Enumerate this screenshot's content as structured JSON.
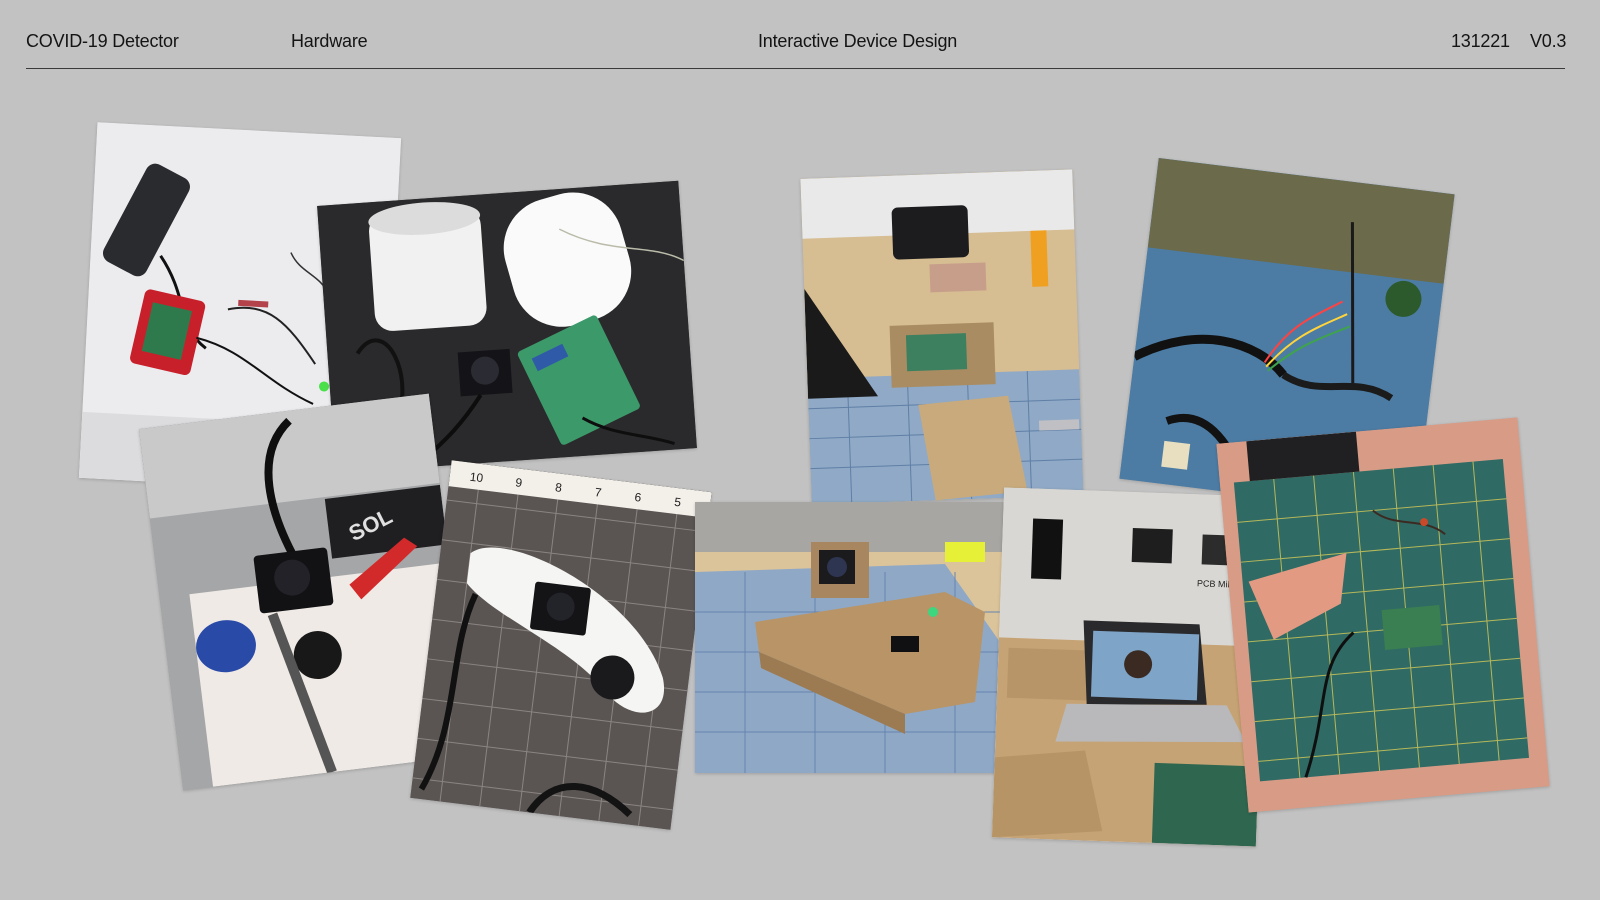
{
  "header": {
    "project": "COVID-19 Detector",
    "section": "Hardware",
    "course": "Interactive Device Design",
    "date": "131221",
    "version": "V0.3"
  },
  "gallery": {
    "photos": [
      {
        "id": "photo-pi-setup",
        "printed_text": []
      },
      {
        "id": "photo-pvc-enclosure",
        "printed_text": []
      },
      {
        "id": "photo-camera-helping-hand",
        "printed_text": [
          "SOL"
        ]
      },
      {
        "id": "photo-board-on-mat",
        "printed_text": [
          "10",
          "9",
          "8",
          "7",
          "6",
          "5"
        ]
      },
      {
        "id": "photo-workbench",
        "printed_text": []
      },
      {
        "id": "photo-cables",
        "printed_text": []
      },
      {
        "id": "photo-cardboard-box",
        "printed_text": []
      },
      {
        "id": "photo-laptop-lab",
        "printed_text": [
          "PCB Milling"
        ]
      },
      {
        "id": "photo-cutting-mat",
        "printed_text": []
      }
    ]
  }
}
